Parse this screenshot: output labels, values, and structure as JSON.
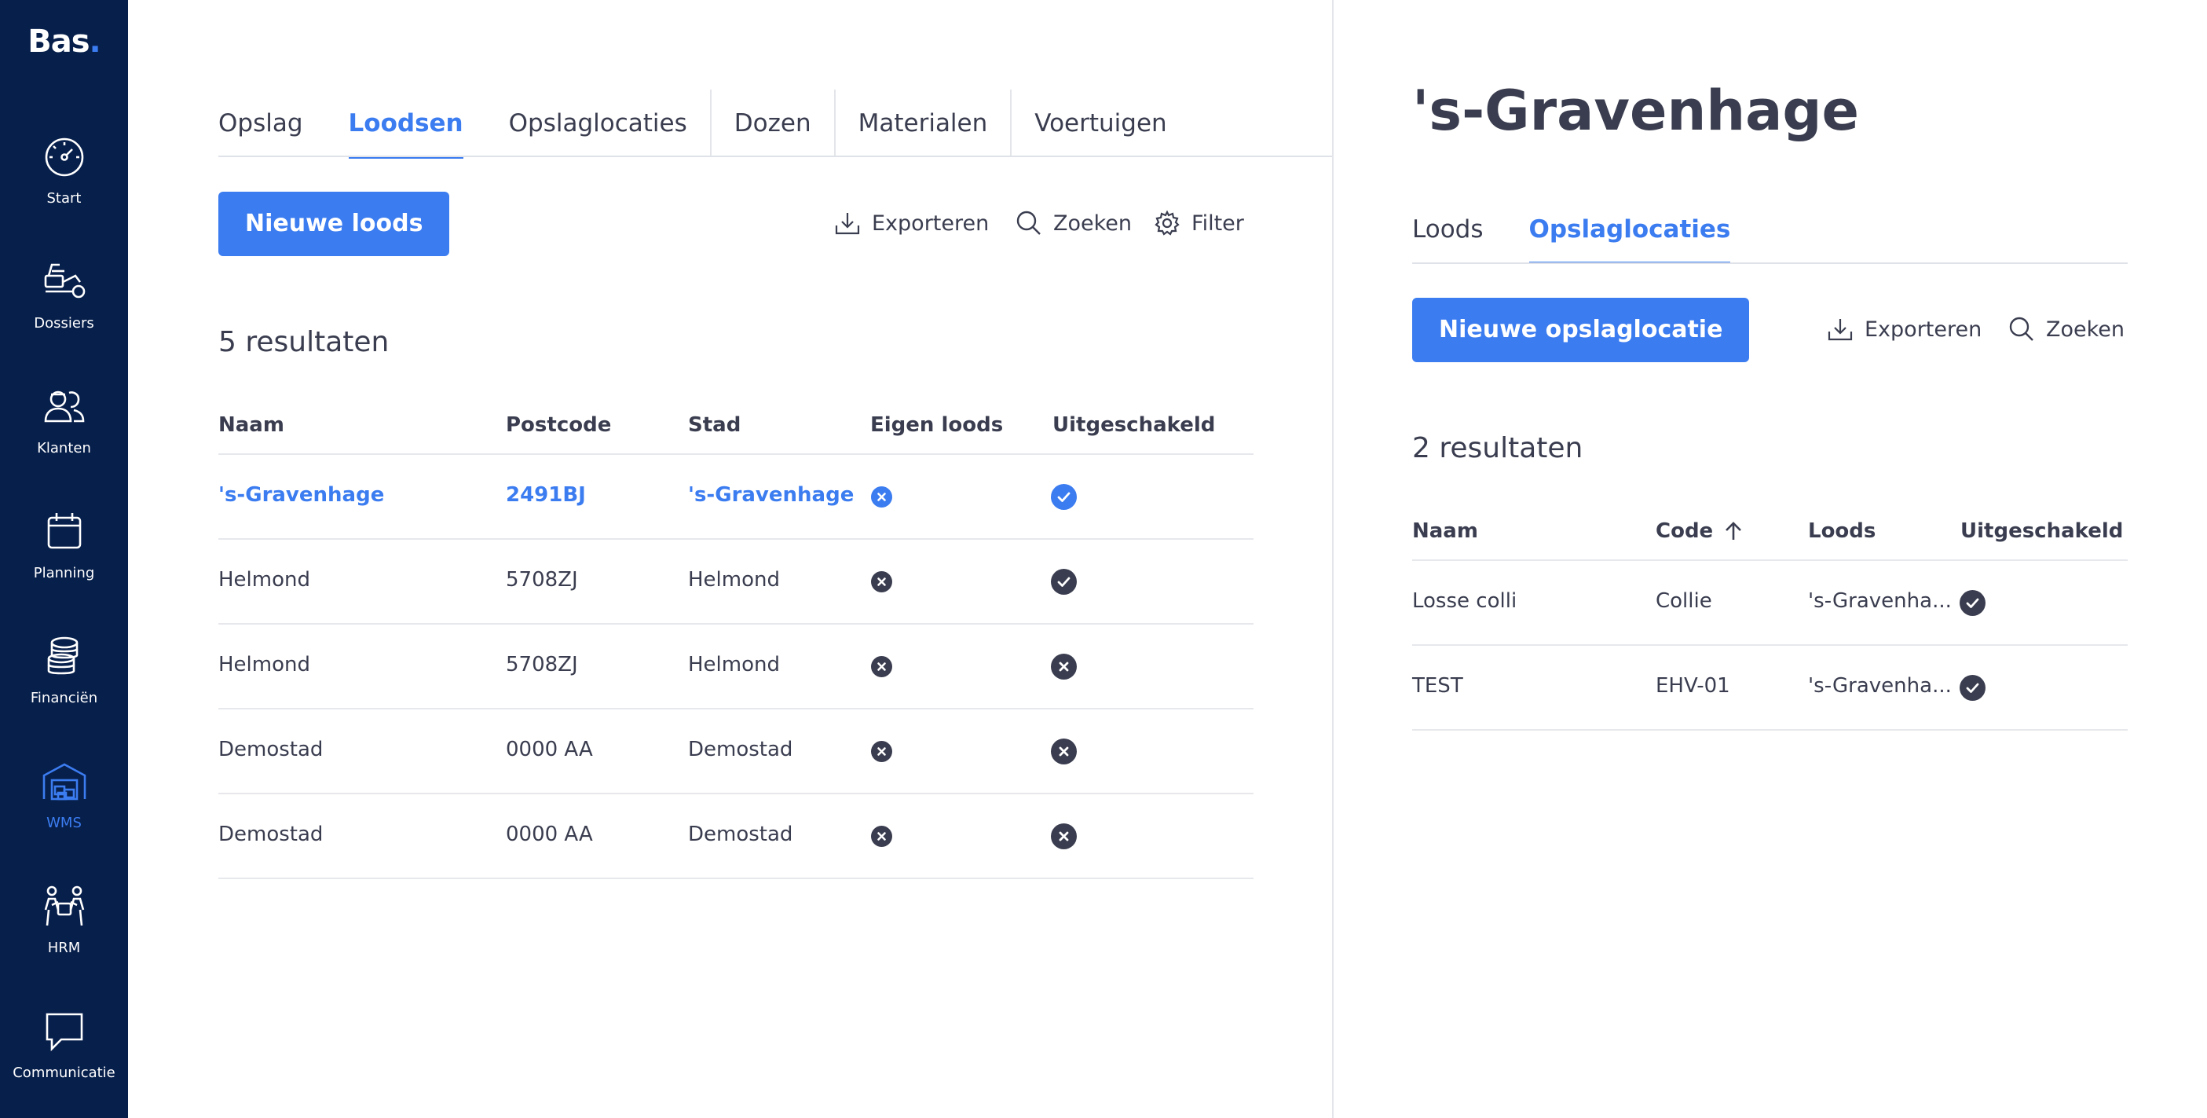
{
  "sidebar": {
    "logo": "Bas",
    "logo_dot": ".",
    "items": [
      {
        "label": "Start",
        "icon": "gauge-icon"
      },
      {
        "label": "Dossiers",
        "icon": "truck-icon"
      },
      {
        "label": "Klanten",
        "icon": "users-icon"
      },
      {
        "label": "Planning",
        "icon": "calendar-icon"
      },
      {
        "label": "Financiën",
        "icon": "coins-icon"
      },
      {
        "label": "WMS",
        "icon": "warehouse-icon",
        "active": true
      },
      {
        "label": "HRM",
        "icon": "team-icon"
      },
      {
        "label": "Communicatie",
        "icon": "chat-icon"
      }
    ]
  },
  "left": {
    "tabs": [
      "Opslag",
      "Loodsen",
      "Opslaglocaties",
      "Dozen",
      "Materialen",
      "Voertuigen"
    ],
    "active_tab": "Loodsen",
    "new_button": "Nieuwe loods",
    "tools": {
      "export": "Exporteren",
      "search": "Zoeken",
      "filter": "Filter"
    },
    "results": "5 resultaten",
    "columns": [
      "Naam",
      "Postcode",
      "Stad",
      "Eigen loods",
      "Uitgeschakeld"
    ],
    "rows": [
      {
        "naam": "'s-Gravenhage",
        "postcode": "2491BJ",
        "stad": "'s-Gravenhage",
        "eigen_loods": false,
        "uitgeschakeld": true,
        "selected": true
      },
      {
        "naam": "Helmond",
        "postcode": "5708ZJ",
        "stad": "Helmond",
        "eigen_loods": false,
        "uitgeschakeld": true
      },
      {
        "naam": "Helmond",
        "postcode": "5708ZJ",
        "stad": "Helmond",
        "eigen_loods": false,
        "uitgeschakeld": false
      },
      {
        "naam": "Demostad",
        "postcode": "0000 AA",
        "stad": "Demostad",
        "eigen_loods": false,
        "uitgeschakeld": false
      },
      {
        "naam": "Demostad",
        "postcode": "0000 AA",
        "stad": "Demostad",
        "eigen_loods": false,
        "uitgeschakeld": false
      }
    ]
  },
  "right": {
    "title": "'s-Gravenhage",
    "tabs": [
      "Loods",
      "Opslaglocaties"
    ],
    "active_tab": "Opslaglocaties",
    "new_button": "Nieuwe opslaglocatie",
    "tools": {
      "export": "Exporteren",
      "search": "Zoeken"
    },
    "results": "2 resultaten",
    "columns": [
      "Naam",
      "Code",
      "Loods",
      "Uitgeschakeld"
    ],
    "sort_column": "Code",
    "rows": [
      {
        "naam": "Losse colli",
        "code": "Collie",
        "loods": "'s-Gravenha...",
        "uitgeschakeld": true
      },
      {
        "naam": "TEST",
        "code": "EHV-01",
        "loods": "'s-Gravenha...",
        "uitgeschakeld": true
      }
    ]
  },
  "colors": {
    "sidebar": "#071f4b",
    "accent": "#3b7cf0",
    "text": "#3a3d4f"
  }
}
